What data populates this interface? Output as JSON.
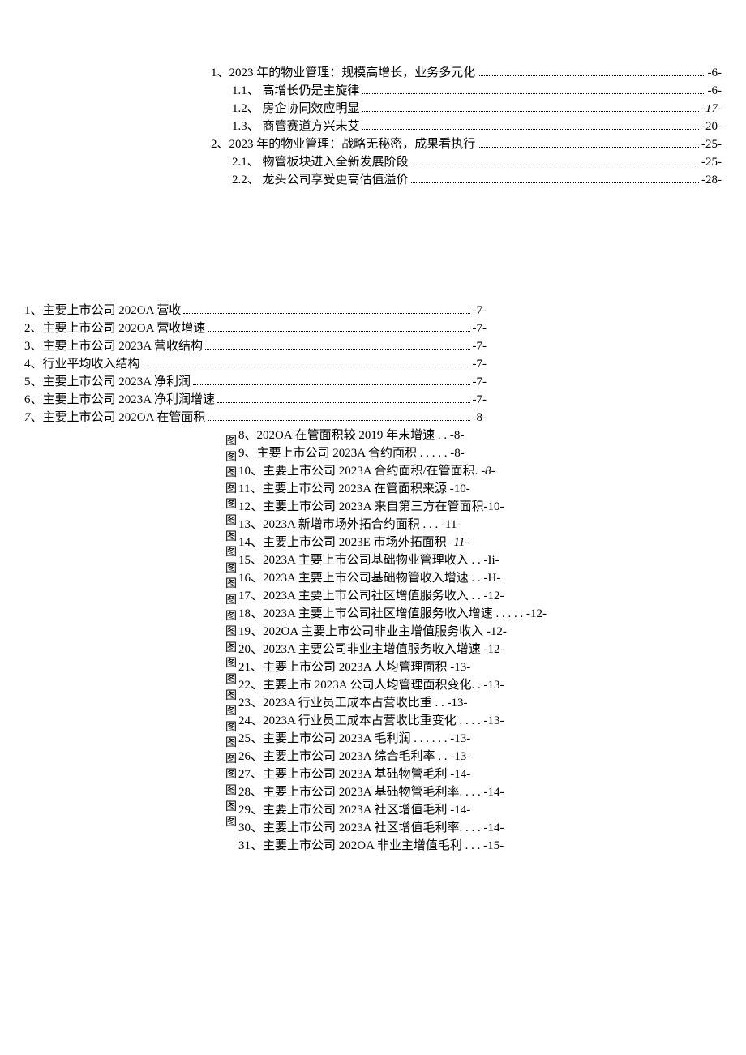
{
  "toc_upper": [
    {
      "label": "1、2023 年的物业管理：规模高增长，业务多元化",
      "page": "-6-",
      "indent": 0
    },
    {
      "label": "1.1、 高增长仍是主旋律",
      "page": "-6-",
      "indent": 1
    },
    {
      "label": "1.2、 房企协同效应明显",
      "page": "-17-",
      "indent": 1,
      "italic_page": true
    },
    {
      "label": "1.3、 商管赛道方兴未艾",
      "page": "-20-",
      "indent": 1
    },
    {
      "label": "2、2023 年的物业管理：战略无秘密，成果看执行",
      "page": "-25-",
      "indent": 0
    },
    {
      "label": "2.1、 物管板块进入全新发展阶段",
      "page": "-25-",
      "indent": 1
    },
    {
      "label": "2.2、 龙头公司享受更高估值溢价",
      "page": "-28-",
      "indent": 1
    }
  ],
  "toc_lower_left": [
    {
      "label": "1、主要上市公司 202OA 营收",
      "page": "-7-"
    },
    {
      "label": "2、主要上市公司 202OA 营收增速",
      "page": "-7-"
    },
    {
      "label": "3、主要上市公司 2023A 营收结构",
      "page": "-7-"
    },
    {
      "label": "4、行业平均收入结构",
      "page": "-7-"
    },
    {
      "label": "5、主要上市公司 2023A 净利润",
      "page": "-7-"
    },
    {
      "label": "6、主要上市公司 2023A 净利润增速",
      "page": "-7-"
    },
    {
      "label": "7、主要上市公司 202OA 在管面积",
      "page": "-8-",
      "italic_num": true
    }
  ],
  "tu_label": "图",
  "toc_lower_right": [
    "8、202OA 在管面积较 2019 年末增速 . . -8-",
    "9、主要上市公司 2023A 合约面积 . . . . . -8-",
    "10、主要上市公司 2023A 合约面积/在管面积. -8-",
    "11、主要上市公司 2023A 在管面积来源 -10-",
    "12、主要上市公司 2023A 来自第三方在管面积-10-",
    "13、2023A 新增市场外拓合约面积  . . . -11-",
    "14、主要上市公司 2023E 市场外拓面积 -11-",
    "15、2023A 主要上市公司基础物业管理收入 . . -Ii-",
    "16、2023A 主要上市公司基础物管收入增速 . . -H-",
    "17、2023A 主要上市公司社区增值服务收入 . . -12-",
    "18、2023A 主要上市公司社区增值服务收入增速  . . . . . -12-",
    "19、202OA 主要上市公司非业主增值服务收入 -12-",
    "20、2023A 主要公司非业主增值服务收入增速 -12-",
    "21、主要上市公司 2023A 人均管理面积 -13-",
    "22、主要上市 2023A 公司人均管理面积变化. . -13-",
    "23、2023A 行业员工成本占营收比重  . . -13-",
    "24、2023A 行业员工成本占营收比重变化 . . . . -13-",
    "25、主要上市公司 2023A 毛利润 . . . . . . -13-",
    "26、主要上市公司 2023A 综合毛利率 . . -13-",
    "27、主要上市公司 2023A 基础物管毛利 -14-",
    "28、主要上市公司 2023A 基础物管毛利率. . . . -14-",
    "29、主要上市公司 2023A 社区增值毛利 -14-",
    "30、主要上市公司 2023A 社区增值毛利率. . . . -14-",
    "31、主要上市公司 202OA 非业主增值毛利  . . . -15-"
  ]
}
